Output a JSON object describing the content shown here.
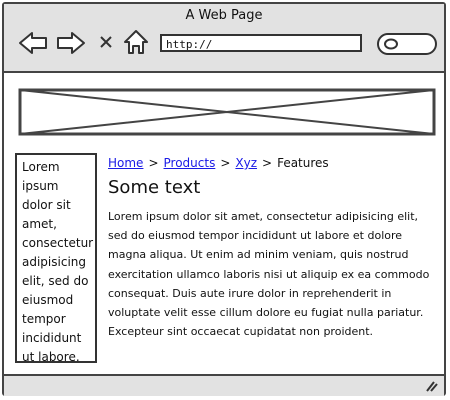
{
  "window": {
    "title": "A Web Page"
  },
  "toolbar": {
    "back_icon": "arrow-left-icon",
    "forward_icon": "arrow-right-icon",
    "stop_icon": "close-icon",
    "home_icon": "home-icon",
    "url_value": "http://",
    "search_icon": "search-field-icon"
  },
  "banner": {
    "icon": "image-placeholder-icon"
  },
  "sidebar": {
    "text": "Lorem ipsum dolor sit amet, consectetur adipisicing elit, sed do eiusmod tempor incididunt ut labore."
  },
  "breadcrumb": {
    "links": [
      "Home",
      "Products",
      "Xyz"
    ],
    "current": "Features",
    "separator": ">"
  },
  "main": {
    "heading": "Some text",
    "body": "Lorem ipsum dolor sit amet, consectetur adipisicing elit, sed do eiusmod tempor incididunt ut labore et dolore magna aliqua. Ut enim ad minim veniam, quis nostrud exercitation ullamco laboris nisi ut aliquip ex ea commodo consequat. Duis aute irure dolor in reprehenderit in voluptate velit esse cillum dolore eu fugiat nulla pariatur. Excepteur sint occaecat cupidatat non proident."
  },
  "statusbar": {
    "icon": "resize-grip-icon"
  },
  "colors": {
    "chrome": "#e2e2e2",
    "link": "#1a1ae6",
    "border": "#444444"
  }
}
